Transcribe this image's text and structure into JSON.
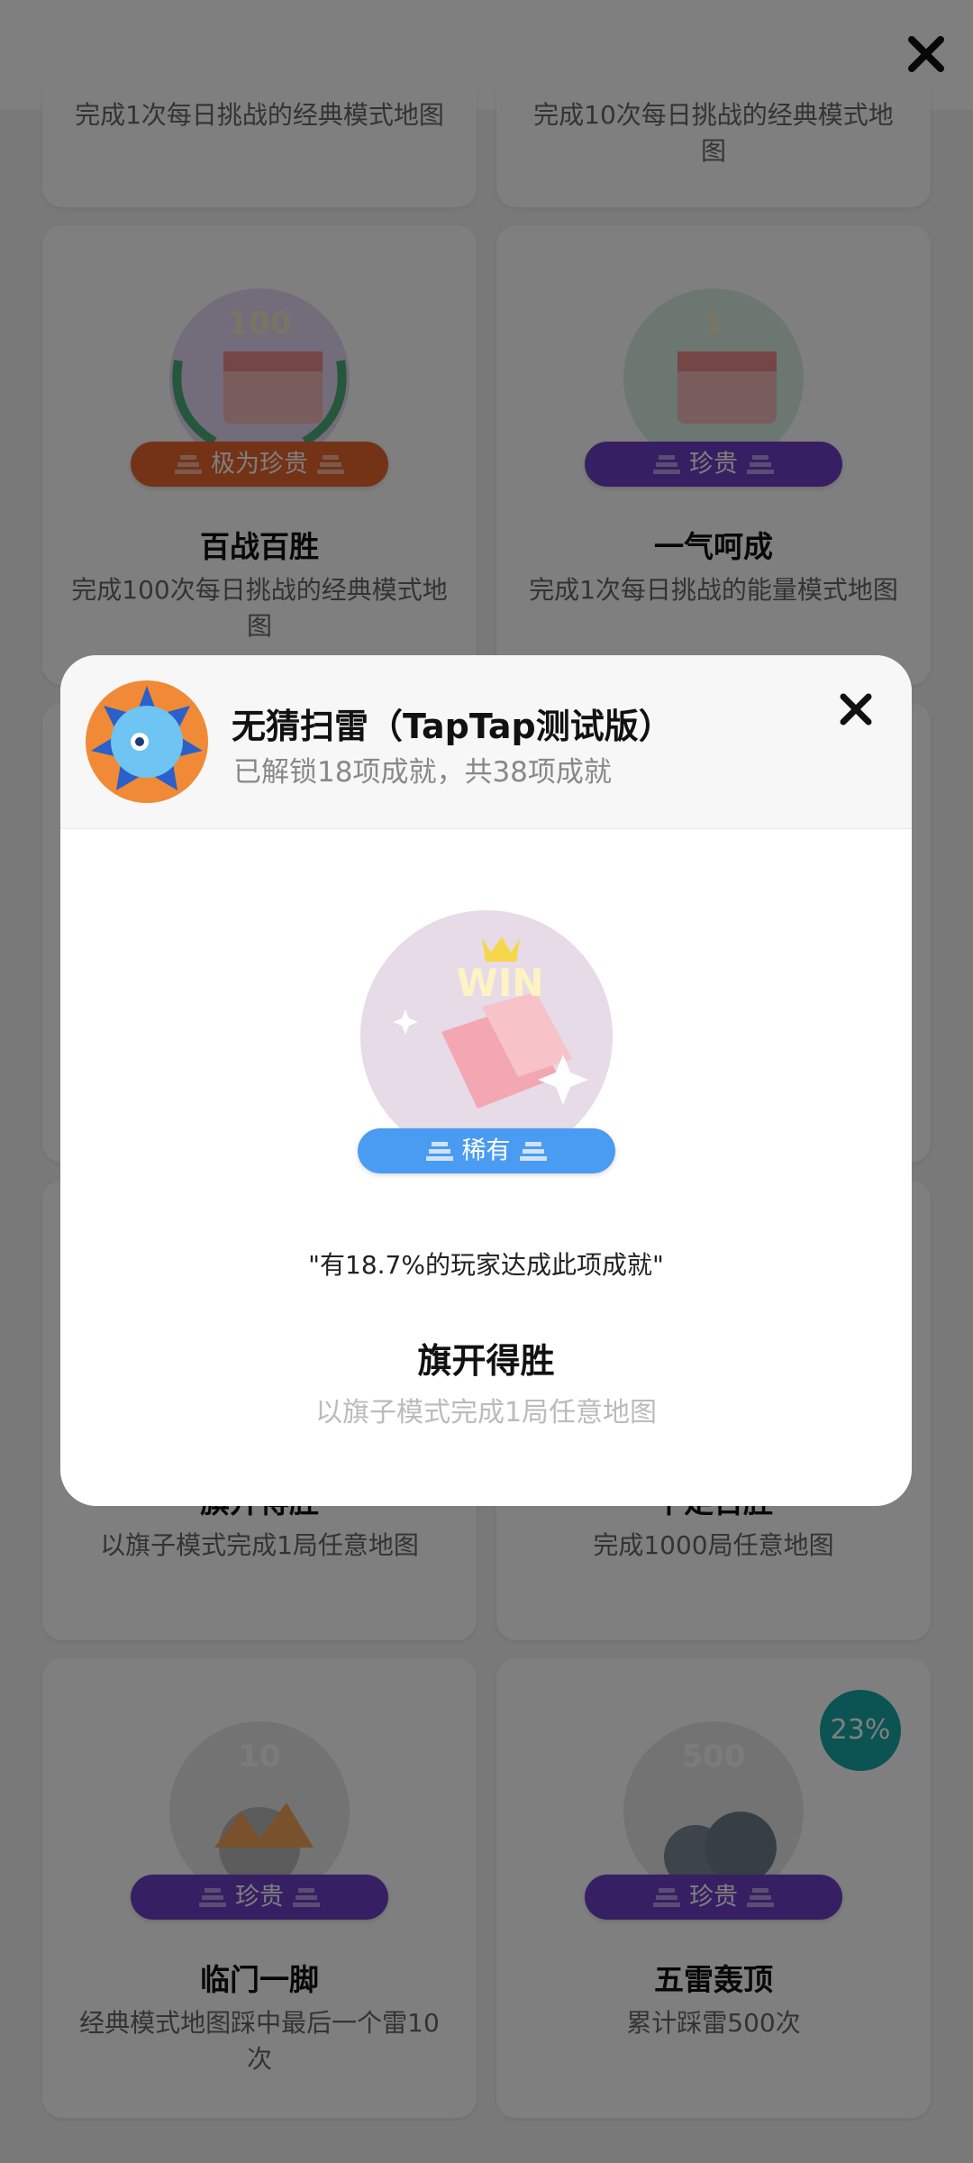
{
  "top_row": {
    "left_desc": "完成1次每日挑战的经典模式地图",
    "right_desc": "完成10次每日挑战的经典模式地图"
  },
  "row2": {
    "left": {
      "rarity": "极为珍贵",
      "title": "百战百胜",
      "desc": "完成100次每日挑战的经典模式地图",
      "badge_number": "100"
    },
    "right": {
      "rarity": "珍贵",
      "title": "一气呵成",
      "desc": "完成1次每日挑战的能量模式地图",
      "badge_number": "1"
    }
  },
  "row4": {
    "left": {
      "title": "旗开得胜",
      "desc": "以旗子模式完成1局任意地图"
    },
    "right": {
      "title": "千足百胜",
      "desc": "完成1000局任意地图"
    }
  },
  "row5": {
    "left": {
      "rarity": "珍贵",
      "title": "临门一脚",
      "desc": "经典模式地图踩中最后一个雷10次",
      "badge_number": "10"
    },
    "right": {
      "rarity": "珍贵",
      "title": "五雷轰顶",
      "desc": "累计踩雷500次",
      "badge_number": "500",
      "progress_label": "23%",
      "progress": 0.23
    }
  },
  "modal": {
    "app_title": "无猜扫雷（TapTap测试版）",
    "subtitle": "已解锁18项成就，共38项成就",
    "badge_text": "WIN",
    "rarity": "稀有",
    "quote": "\"有18.7%的玩家达成此项成就\"",
    "achievement_title": "旗开得胜",
    "achievement_desc": "以旗子模式完成1局任意地图"
  },
  "colors": {
    "very_precious": "#e8642c",
    "precious": "#6c3fc5",
    "rare": "#4a9bf2",
    "progress": "#19a6a6"
  },
  "icons": [
    "close-icon",
    "minesweeper-app-icon"
  ]
}
